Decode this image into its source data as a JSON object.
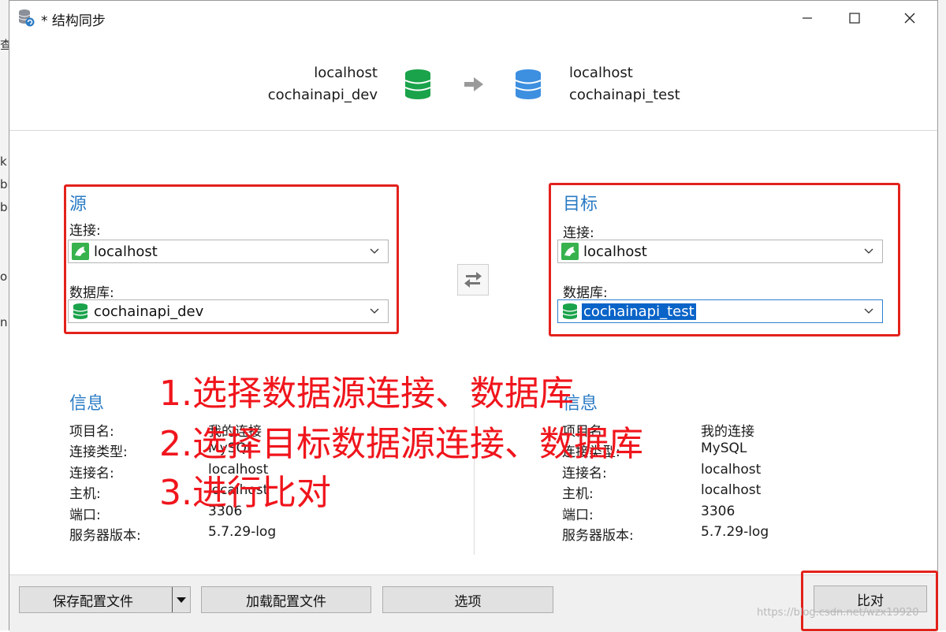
{
  "window": {
    "title": "* 结构同步"
  },
  "background": {
    "left_fragments": [
      "查",
      "k",
      "bi",
      "bi",
      "o",
      "n"
    ]
  },
  "header": {
    "source": {
      "host": "localhost",
      "database": "cochainapi_dev"
    },
    "target": {
      "host": "localhost",
      "database": "cochainapi_test"
    }
  },
  "source_panel": {
    "title": "源",
    "connection_label": "连接:",
    "connection_value": "localhost",
    "database_label": "数据库:",
    "database_value": "cochainapi_dev"
  },
  "target_panel": {
    "title": "目标",
    "connection_label": "连接:",
    "connection_value": "localhost",
    "database_label": "数据库:",
    "database_value": "cochainapi_test"
  },
  "source_info": {
    "title": "信息",
    "rows": [
      {
        "key": "项目名:",
        "value": "我的连接"
      },
      {
        "key": "连接类型:",
        "value": "MySQL"
      },
      {
        "key": "连接名:",
        "value": "localhost"
      },
      {
        "key": "主机:",
        "value": "localhost"
      },
      {
        "key": "端口:",
        "value": "3306"
      },
      {
        "key": "服务器版本:",
        "value": "5.7.29-log"
      }
    ]
  },
  "target_info": {
    "title": "信息",
    "rows": [
      {
        "key": "项目名:",
        "value": "我的连接"
      },
      {
        "key": "连接类型:",
        "value": "MySQL"
      },
      {
        "key": "连接名:",
        "value": "localhost"
      },
      {
        "key": "主机:",
        "value": "localhost"
      },
      {
        "key": "端口:",
        "value": "3306"
      },
      {
        "key": "服务器版本:",
        "value": "5.7.29-log"
      }
    ]
  },
  "annotations": [
    "1.选择数据源连接、数据库",
    "2.选择目标数据源连接、数据库",
    "3.进行比对"
  ],
  "footer": {
    "save_profile": "保存配置文件",
    "load_profile": "加载配置文件",
    "options": "选项",
    "compare": "比对"
  },
  "watermark": "https://blog.csdn.net/wzx19920",
  "colors": {
    "accent_blue": "#2a7bc4",
    "source_db_green": "#1aa34a",
    "target_db_blue": "#3d8fe0",
    "annotation_red": "#f0151c",
    "selection_blue": "#0a64c8"
  },
  "icons": {
    "app": "database-sync-icon",
    "connection": "mysql-dolphin-icon",
    "database": "database-icon",
    "swap": "swap-arrows-icon",
    "arrow": "arrow-right-icon"
  }
}
